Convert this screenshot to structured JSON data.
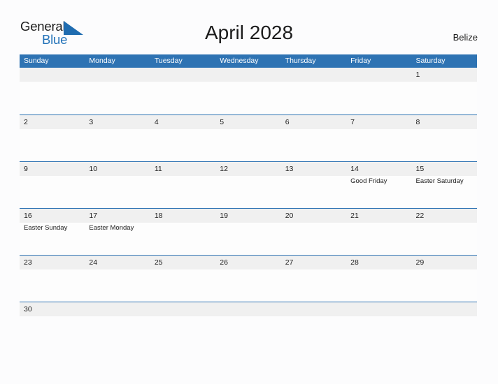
{
  "brand": {
    "name_part1": "General",
    "name_part2": "Blue",
    "flag_icon": "blue-triangle-flag-icon",
    "accent_color": "#2272b8"
  },
  "header": {
    "title": "April 2028",
    "locale": "Belize"
  },
  "colors": {
    "header_blue": "#2e73b3",
    "row_divider": "#2e73b3",
    "daynum_band": "#f0f0f0",
    "page_background": "#fcfcfd",
    "text": "#1c1c1c"
  },
  "calendar": {
    "month": "April",
    "year": "2028",
    "weekday_headers": [
      "Sunday",
      "Monday",
      "Tuesday",
      "Wednesday",
      "Thursday",
      "Friday",
      "Saturday"
    ],
    "weeks": [
      {
        "days": [
          {
            "num": "",
            "events": []
          },
          {
            "num": "",
            "events": []
          },
          {
            "num": "",
            "events": []
          },
          {
            "num": "",
            "events": []
          },
          {
            "num": "",
            "events": []
          },
          {
            "num": "",
            "events": []
          },
          {
            "num": "1",
            "events": []
          }
        ]
      },
      {
        "days": [
          {
            "num": "2",
            "events": []
          },
          {
            "num": "3",
            "events": []
          },
          {
            "num": "4",
            "events": []
          },
          {
            "num": "5",
            "events": []
          },
          {
            "num": "6",
            "events": []
          },
          {
            "num": "7",
            "events": []
          },
          {
            "num": "8",
            "events": []
          }
        ]
      },
      {
        "days": [
          {
            "num": "9",
            "events": []
          },
          {
            "num": "10",
            "events": []
          },
          {
            "num": "11",
            "events": []
          },
          {
            "num": "12",
            "events": []
          },
          {
            "num": "13",
            "events": []
          },
          {
            "num": "14",
            "events": [
              "Good Friday"
            ]
          },
          {
            "num": "15",
            "events": [
              "Easter Saturday"
            ]
          }
        ]
      },
      {
        "days": [
          {
            "num": "16",
            "events": [
              "Easter Sunday"
            ]
          },
          {
            "num": "17",
            "events": [
              "Easter Monday"
            ]
          },
          {
            "num": "18",
            "events": []
          },
          {
            "num": "19",
            "events": []
          },
          {
            "num": "20",
            "events": []
          },
          {
            "num": "21",
            "events": []
          },
          {
            "num": "22",
            "events": []
          }
        ]
      },
      {
        "days": [
          {
            "num": "23",
            "events": []
          },
          {
            "num": "24",
            "events": []
          },
          {
            "num": "25",
            "events": []
          },
          {
            "num": "26",
            "events": []
          },
          {
            "num": "27",
            "events": []
          },
          {
            "num": "28",
            "events": []
          },
          {
            "num": "29",
            "events": []
          }
        ]
      },
      {
        "days": [
          {
            "num": "30",
            "events": []
          },
          {
            "num": "",
            "events": []
          },
          {
            "num": "",
            "events": []
          },
          {
            "num": "",
            "events": []
          },
          {
            "num": "",
            "events": []
          },
          {
            "num": "",
            "events": []
          },
          {
            "num": "",
            "events": []
          }
        ]
      }
    ]
  }
}
